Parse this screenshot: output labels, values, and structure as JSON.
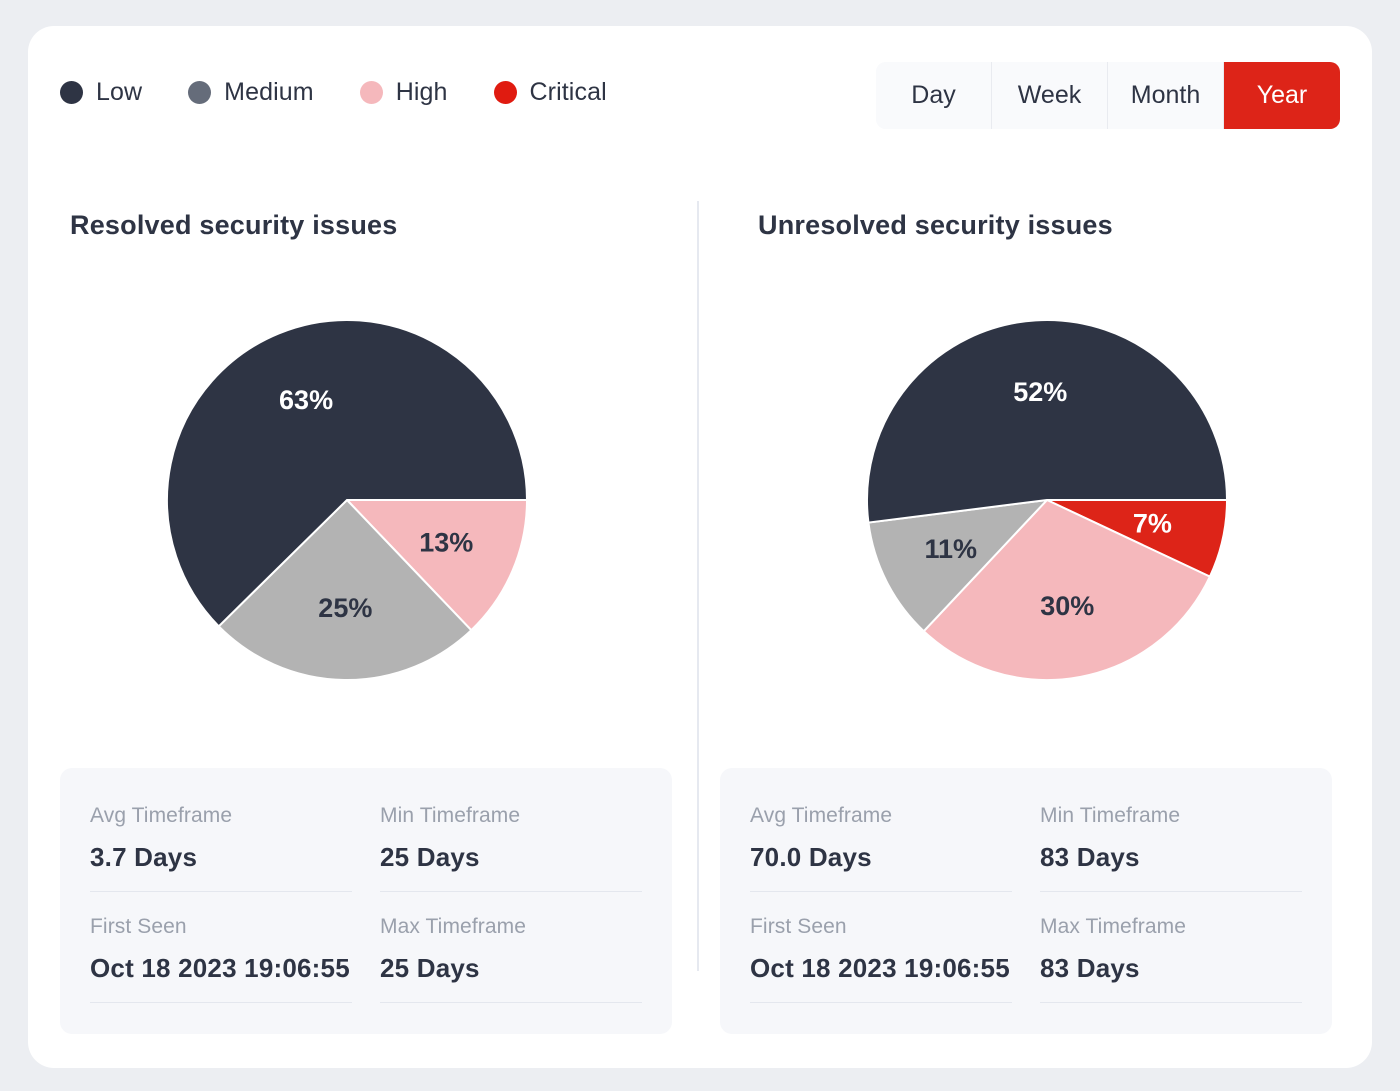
{
  "legend": {
    "items": [
      {
        "label": "Low",
        "color": "#2e3444"
      },
      {
        "label": "Medium",
        "color": "#656c7a"
      },
      {
        "label": "High",
        "color": "#f5b8bc"
      },
      {
        "label": "Critical",
        "color": "#e01b10"
      }
    ]
  },
  "timeframe_selector": {
    "options": [
      "Day",
      "Week",
      "Month",
      "Year"
    ],
    "selected": "Year",
    "active_color": "#dd2418"
  },
  "panels": [
    {
      "title": "Resolved security issues",
      "stats": [
        {
          "label": "Avg Timeframe",
          "value": "3.7 Days"
        },
        {
          "label": "Min Timeframe",
          "value": "25 Days"
        },
        {
          "label": "First Seen",
          "value": "Oct 18 2023 19:06:55"
        },
        {
          "label": "Max Timeframe",
          "value": "25 Days"
        }
      ]
    },
    {
      "title": "Unresolved security issues",
      "stats": [
        {
          "label": "Avg Timeframe",
          "value": "70.0 Days"
        },
        {
          "label": "Min Timeframe",
          "value": "83 Days"
        },
        {
          "label": "First Seen",
          "value": "Oct 18 2023 19:06:55"
        },
        {
          "label": "Max Timeframe",
          "value": "83 Days"
        }
      ]
    }
  ],
  "chart_data": [
    {
      "type": "pie",
      "title": "Resolved security issues",
      "radius": 180,
      "start_angle": 0,
      "direction": "clockwise",
      "labels": [
        "High",
        "Medium",
        "Low"
      ],
      "values": [
        13,
        25,
        63
      ],
      "display_labels": [
        "13%",
        "25%",
        "63%"
      ],
      "colors": [
        "#f5b8bc",
        "#b3b3b3",
        "#2e3444"
      ],
      "label_colors": [
        "#2e3444",
        "#2e3444",
        "#ffffff"
      ],
      "legend_position": "top-left",
      "grid": false
    },
    {
      "type": "pie",
      "title": "Unresolved security issues",
      "radius": 180,
      "start_angle": 0,
      "direction": "clockwise",
      "labels": [
        "Critical",
        "High",
        "Medium",
        "Low"
      ],
      "values": [
        7,
        30,
        11,
        52
      ],
      "display_labels": [
        "7%",
        "30%",
        "11%",
        "52%"
      ],
      "colors": [
        "#dd2418",
        "#f5b8bc",
        "#b3b3b3",
        "#2e3444"
      ],
      "label_colors": [
        "#ffffff",
        "#2e3444",
        "#2e3444",
        "#ffffff"
      ],
      "legend_position": "top-left",
      "grid": false
    }
  ]
}
